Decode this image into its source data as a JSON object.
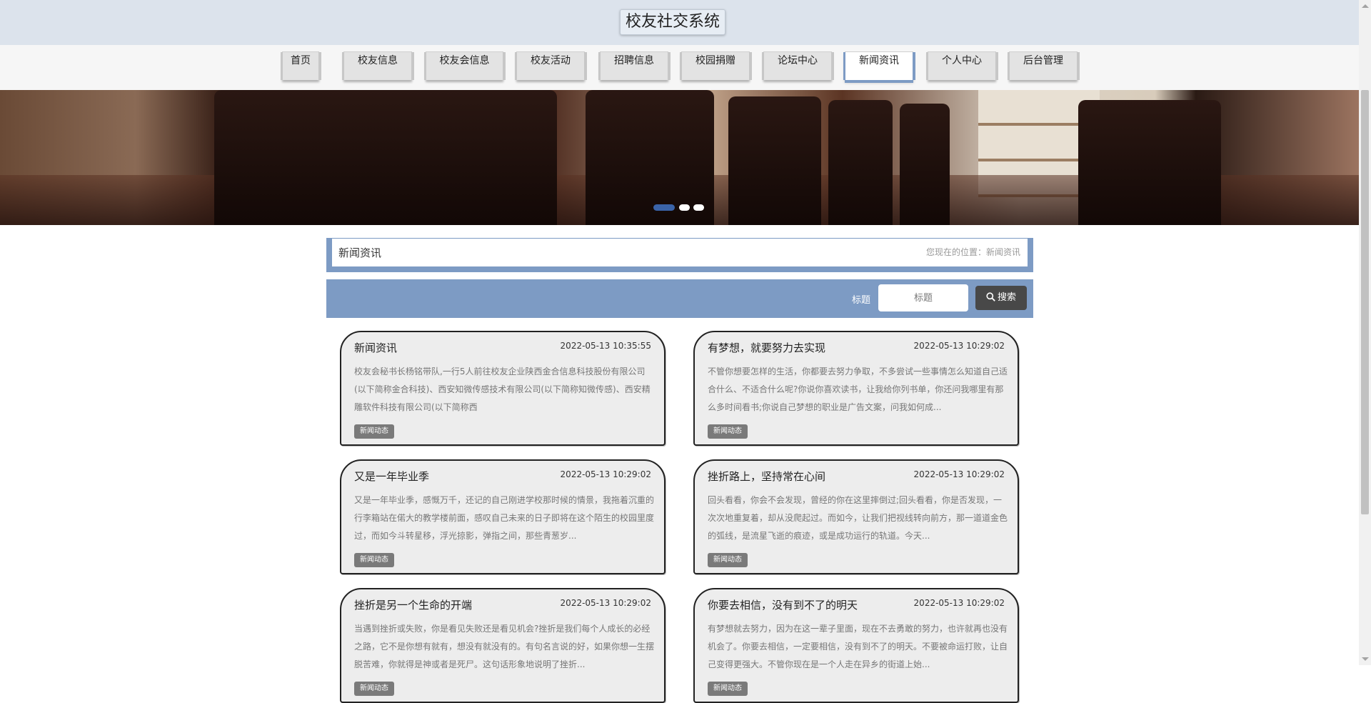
{
  "header": {
    "title": "校友社交系统"
  },
  "nav": {
    "items": [
      {
        "label": "首页"
      },
      {
        "label": "校友信息"
      },
      {
        "label": "校友会信息"
      },
      {
        "label": "校友活动"
      },
      {
        "label": "招聘信息"
      },
      {
        "label": "校园捐赠"
      },
      {
        "label": "论坛中心"
      },
      {
        "label": "新闻资讯",
        "active": true
      },
      {
        "label": "个人中心"
      },
      {
        "label": "后台管理"
      }
    ]
  },
  "carousel": {
    "slide_count": 3,
    "active_index": 0
  },
  "breadcrumb": {
    "title": "新闻资讯",
    "location": "您现在的位置：新闻资讯"
  },
  "search": {
    "label": "标题",
    "placeholder": "标题",
    "button_label": "搜索"
  },
  "news": [
    {
      "title": "新闻资讯",
      "date": "2022-05-13 10:35:55",
      "desc": "校友会秘书长杨铭带队,一行5人前往校友企业陕西金合信息科技股份有限公司(以下简称金合科技)、西安知微传感技术有限公司(以下简称知微传感)、西安精雕软件科技有限公司(以下简称西",
      "tag": "新闻动态"
    },
    {
      "title": "有梦想，就要努力去实现",
      "date": "2022-05-13 10:29:02",
      "desc": "不管你想要怎样的生活，你都要去努力争取，不多尝试一些事情怎么知道自己适合什么、不适合什么呢?你说你喜欢读书，让我给你列书单，你还问我哪里有那么多时间看书;你说自己梦想的职业是广告文案，问我如何成...",
      "tag": "新闻动态"
    },
    {
      "title": "又是一年毕业季",
      "date": "2022-05-13 10:29:02",
      "desc": "又是一年毕业季，感慨万千，还记的自己刚进学校那时候的情景，我拖着沉重的行李箱站在偌大的教学楼前面，感叹自己未来的日子即将在这个陌生的校园里度过，而如今斗转星移，浮光掠影，弹指之间，那些青葱岁...",
      "tag": "新闻动态"
    },
    {
      "title": "挫折路上，坚持常在心间",
      "date": "2022-05-13 10:29:02",
      "desc": "回头看看，你会不会发现，曾经的你在这里摔倒过;回头看看，你是否发现，一次次地重复着，却从没爬起过。而如今，让我们把视线转向前方，那一道道金色的弧线，是流星飞逝的痕迹，或是成功运行的轨道。今天...",
      "tag": "新闻动态"
    },
    {
      "title": "挫折是另一个生命的开端",
      "date": "2022-05-13 10:29:02",
      "desc": "当遇到挫折或失败，你是看见失败还是看见机会?挫折是我们每个人成长的必经之路，它不是你想有就有，想没有就没有的。有句名言说的好，如果你想一生摆脱苦难，你就得是神或者是死尸。这句话形象地说明了挫折...",
      "tag": "新闻动态"
    },
    {
      "title": "你要去相信，没有到不了的明天",
      "date": "2022-05-13 10:29:02",
      "desc": "有梦想就去努力，因为在这一辈子里面，现在不去勇敢的努力，也许就再也没有机会了。你要去相信，一定要相信，没有到不了的明天。不要被命运打败，让自己变得更强大。不管你现在是一个人走在异乡的街道上始...",
      "tag": "新闻动态"
    }
  ]
}
